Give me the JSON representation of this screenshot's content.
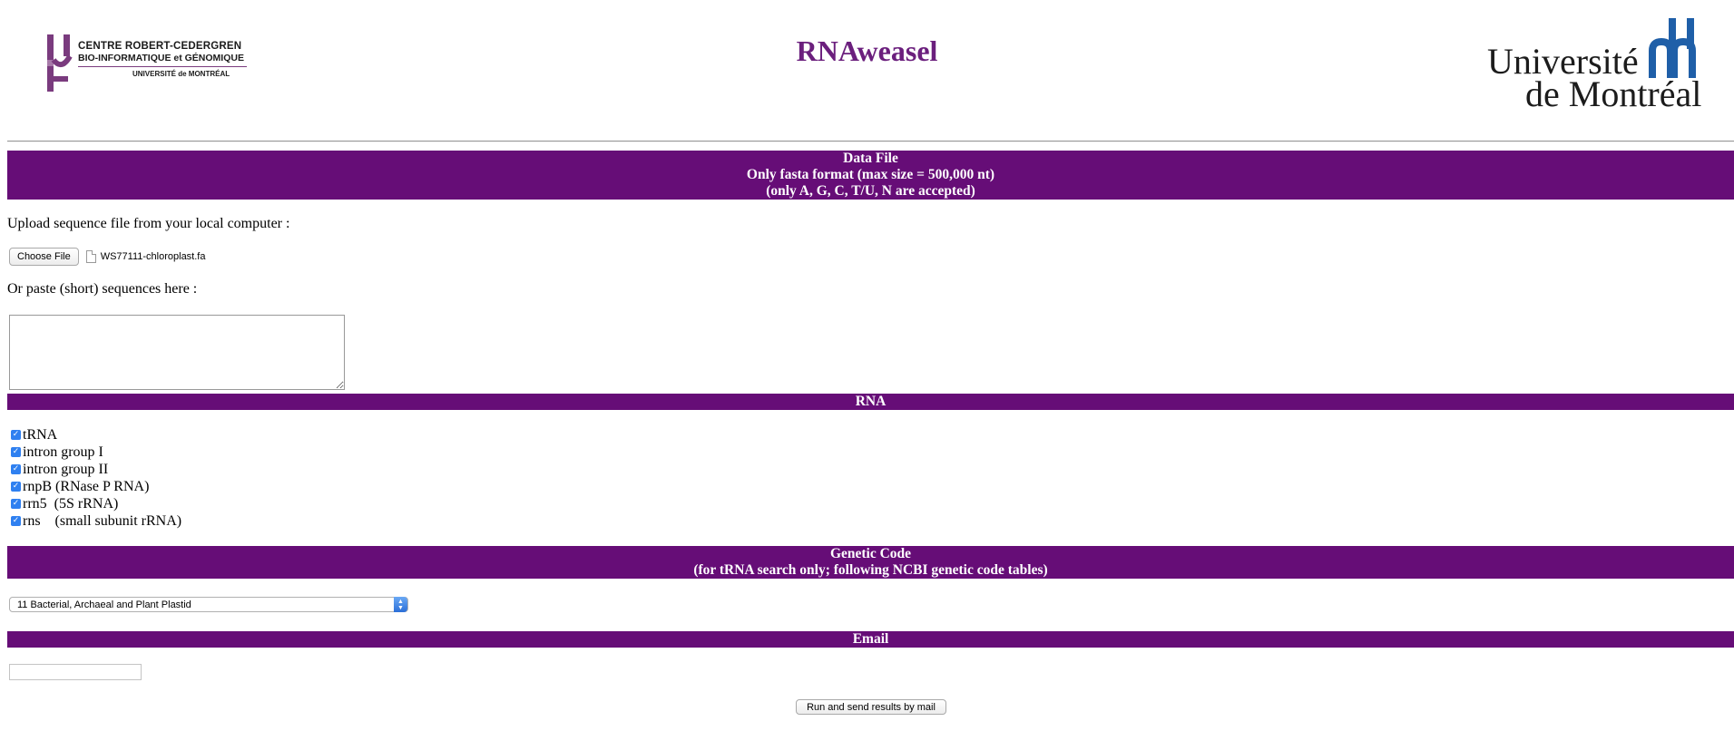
{
  "header": {
    "title": "RNAweasel",
    "left_logo": {
      "line1": "CENTRE ROBERT-CEDERGREN",
      "line2": "BIO-INFORMATIQUE et GÉNOMIQUE",
      "line3": "UNIVERSITÉ de MONTRÉAL",
      "color": "#7a3b7e"
    },
    "right_logo": {
      "line1": "Université",
      "line2": "de Montréal",
      "color": "#1f5fa8"
    }
  },
  "data_file": {
    "band_line1": "Data File",
    "band_line2": "Only fasta format (max size = 500,000 nt)",
    "band_line3": "(only A, G, C, T/U, N are accepted)",
    "upload_label": "Upload sequence file from your local computer :",
    "choose_button": "Choose File",
    "chosen_file": "WS77111-chloroplast.fa",
    "paste_label": "Or paste (short) sequences here :",
    "paste_value": ""
  },
  "rna": {
    "band": "RNA",
    "options": [
      {
        "label": "tRNA",
        "checked": true
      },
      {
        "label": "intron group I",
        "checked": true
      },
      {
        "label": "intron group II",
        "checked": true
      },
      {
        "label": "rnpB (RNase P RNA)",
        "checked": true
      },
      {
        "label": "rrn5  (5S rRNA)",
        "checked": true
      },
      {
        "label": "rns    (small subunit rRNA)",
        "checked": true
      }
    ]
  },
  "genetic_code": {
    "band_line1": "Genetic Code",
    "band_line2": "(for tRNA search only; following NCBI genetic code tables)",
    "selected": "11 Bacterial, Archaeal and Plant Plastid"
  },
  "email": {
    "band": "Email",
    "value": ""
  },
  "submit_label": "Run and send results by mail",
  "colors": {
    "band": "#660d77",
    "title": "#6b1f7d",
    "checkbox": "#2f80f0"
  }
}
